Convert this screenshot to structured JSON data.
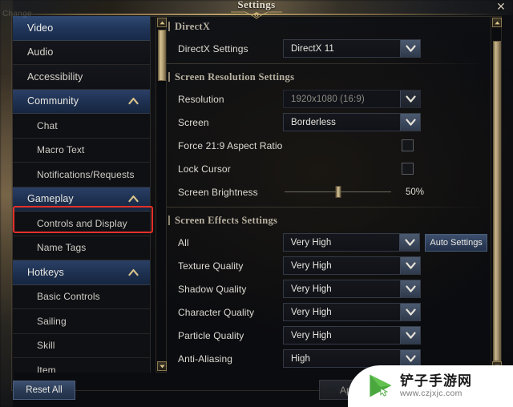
{
  "window": {
    "title": "Settings",
    "close_icon": "close-x-icon",
    "ghost_label": "Change"
  },
  "sidebar": {
    "items": [
      {
        "label": "Video",
        "type": "item",
        "state": "selected"
      },
      {
        "label": "Audio",
        "type": "item",
        "state": "normal"
      },
      {
        "label": "Accessibility",
        "type": "item",
        "state": "normal"
      },
      {
        "label": "Community",
        "type": "group",
        "state": "expanded",
        "caret": "chevron-up-icon"
      },
      {
        "label": "Chat",
        "type": "child",
        "state": "normal"
      },
      {
        "label": "Macro Text",
        "type": "child",
        "state": "normal"
      },
      {
        "label": "Notifications/Requests",
        "type": "child",
        "state": "normal"
      },
      {
        "label": "Gameplay",
        "type": "group",
        "state": "expanded",
        "caret": "chevron-up-icon"
      },
      {
        "label": "Controls and Display",
        "type": "child",
        "state": "highlighted"
      },
      {
        "label": "Name Tags",
        "type": "child",
        "state": "normal"
      },
      {
        "label": "Hotkeys",
        "type": "group",
        "state": "expanded",
        "caret": "chevron-up-icon"
      },
      {
        "label": "Basic Controls",
        "type": "child",
        "state": "normal"
      },
      {
        "label": "Sailing",
        "type": "child",
        "state": "normal"
      },
      {
        "label": "Skill",
        "type": "child",
        "state": "normal"
      },
      {
        "label": "Item",
        "type": "child",
        "state": "normal"
      }
    ],
    "reset_label": "Reset All",
    "scrollbar": {
      "up_icon": "scroll-up-arrow-icon",
      "down_icon": "scroll-down-arrow-icon"
    }
  },
  "content": {
    "sections": [
      {
        "title": "DirectX",
        "rows": [
          {
            "kind": "dropdown",
            "label": "DirectX Settings",
            "value": "DirectX 11",
            "disabled": false
          }
        ]
      },
      {
        "title": "Screen Resolution Settings",
        "rows": [
          {
            "kind": "dropdown",
            "label": "Resolution",
            "value": "1920x1080 (16:9)",
            "disabled": true
          },
          {
            "kind": "dropdown",
            "label": "Screen",
            "value": "Borderless",
            "disabled": false
          },
          {
            "kind": "checkbox",
            "label": "Force 21:9 Aspect Ratio",
            "checked": false
          },
          {
            "kind": "checkbox",
            "label": "Lock Cursor",
            "checked": false
          },
          {
            "kind": "slider",
            "label": "Screen Brightness",
            "value": 50,
            "value_text": "50%"
          }
        ]
      },
      {
        "title": "Screen Effects Settings",
        "rows": [
          {
            "kind": "dropdown",
            "label": "All",
            "value": "Very High",
            "disabled": false,
            "extra_button": "Auto Settings"
          },
          {
            "kind": "dropdown",
            "label": "Texture Quality",
            "value": "Very High",
            "disabled": false
          },
          {
            "kind": "dropdown",
            "label": "Shadow Quality",
            "value": "Very High",
            "disabled": false
          },
          {
            "kind": "dropdown",
            "label": "Character Quality",
            "value": "Very High",
            "disabled": false
          },
          {
            "kind": "dropdown",
            "label": "Particle Quality",
            "value": "Very High",
            "disabled": false
          },
          {
            "kind": "dropdown",
            "label": "Anti-Aliasing",
            "value": "High",
            "disabled": false
          }
        ]
      }
    ]
  },
  "footer": {
    "apply_label": "Apply",
    "ok_label": ""
  },
  "watermark": {
    "name": "铲子手游网",
    "url": "www.czjxjc.com"
  },
  "colors": {
    "highlight_red": "#e5302a",
    "accent_gold": "#c4aa6c",
    "selected_blue": "#2f4a72"
  }
}
